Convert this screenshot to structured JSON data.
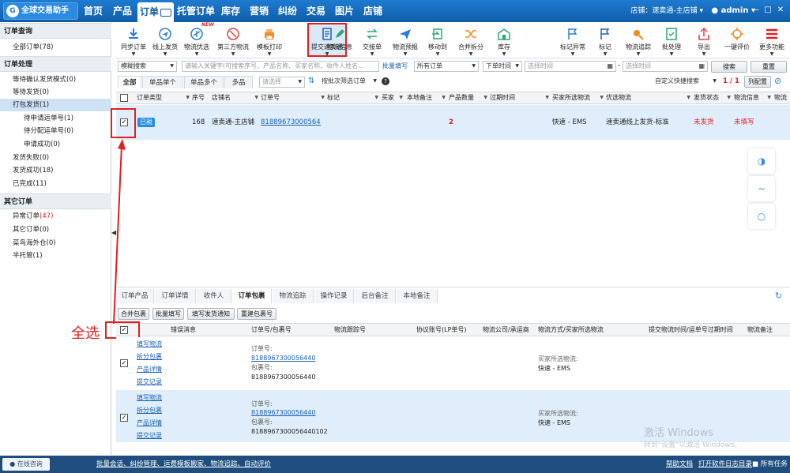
{
  "app": {
    "logo": "全球交易助手",
    "logo_icon": "G"
  },
  "nav": [
    "首页",
    "产品",
    "订单",
    "托管订单",
    "库存",
    "营销",
    "纠纷",
    "交易",
    "图片",
    "店铺"
  ],
  "header": {
    "store": "店铺：速卖通-主店铺",
    "store_arrow": "▾",
    "user": "admin",
    "user_arrow": "▾"
  },
  "left": {
    "sections": [
      {
        "title": "订单查询",
        "items": [
          {
            "label": "全部订单(78)"
          }
        ]
      },
      {
        "title": "订单处理",
        "items": [
          {
            "label": "等待确认发货模式(0)"
          },
          {
            "label": "等待发货(0)"
          },
          {
            "label": "打包发货(1)"
          },
          {
            "label": "待申请运单号(1)"
          },
          {
            "label": "待分配运单号(0)"
          },
          {
            "label": "申请成功(0)"
          },
          {
            "label": "发货失败(0)"
          },
          {
            "label": "发货成功(18)"
          },
          {
            "label": "已完成(11)"
          }
        ]
      },
      {
        "title": "其它订单",
        "items": [
          {
            "label": "异常订单",
            "count": "(47)"
          },
          {
            "label": "其它订单(0)"
          },
          {
            "label": "菜鸟海外仓(0)"
          },
          {
            "label": "半托管(1)"
          }
        ]
      }
    ]
  },
  "toolbar": [
    {
      "label": "同步订单",
      "icon": "download-icon"
    },
    {
      "label": "线上发货",
      "icon": "plane-icon"
    },
    {
      "label": "物流优选",
      "icon": "plane-circle-icon",
      "badge": "NEW"
    },
    {
      "label": "第三方物流",
      "icon": "cancel-plane-icon"
    },
    {
      "label": "模板打印",
      "icon": "printer-icon"
    },
    {
      "label": "提交速卖通",
      "icon": "document-icon"
    },
    {
      "label": "物流信息",
      "icon": "edit-icon"
    },
    {
      "label": "交接单",
      "icon": "swap-icon"
    },
    {
      "label": "物流预报",
      "icon": "send-icon"
    },
    {
      "label": "移动到",
      "icon": "move-icon"
    },
    {
      "label": "合并拆分",
      "icon": "shuffle-icon"
    },
    {
      "label": "库存",
      "icon": "warehouse-icon"
    },
    {
      "label": "标记异常",
      "icon": "flag-icon"
    },
    {
      "label": "标记",
      "icon": "flag-icon"
    },
    {
      "label": "物流追踪",
      "icon": "tracking-icon"
    },
    {
      "label": "批处理",
      "icon": "batch-icon"
    },
    {
      "label": "导出",
      "icon": "export-icon"
    },
    {
      "label": "一键评价",
      "icon": "star-icon"
    },
    {
      "label": "更多功能",
      "icon": "menu-icon"
    }
  ],
  "search": {
    "mode": "模糊搜索",
    "placeholder": "请输入关键字(可搜索序号、产品名称、买家名称、收件人姓名...",
    "batch": "批量填写",
    "order_type": "所有订单",
    "time_type": "下单时间",
    "date_from": "选择时间",
    "date_to": "选择时间",
    "date_sep": "-",
    "search_btn": "搜索",
    "reset_btn": "重置"
  },
  "tabs": [
    "全部",
    "单品单个",
    "单品多个",
    "多品"
  ],
  "filter": {
    "select": "请选择",
    "sort": "按批次筛选订单",
    "help": "?",
    "custom": "自定义快捷搜索",
    "page_cur": "1",
    "page_sep": "/",
    "page_total": "1",
    "columns_btn": "列配置"
  },
  "table": {
    "headers": [
      "订单类型",
      "序号",
      "店铺名",
      "订单号",
      "标记",
      "买家",
      "本地备注",
      "产品数量",
      "过期时间",
      "买家所选物流",
      "优选物流",
      "发货状态",
      "物流信息",
      "物流"
    ],
    "rows": [
      {
        "type": "已税",
        "seq": "168",
        "store": "速卖通-主店铺",
        "order_no": "818896730005644(",
        "qty": "2",
        "buyer_logistics": "快速 - EMS",
        "pref_logistics": "速卖通线上发货-标准",
        "ship_status": "未发货",
        "logistics_info": "未填写"
      }
    ]
  },
  "bottom": {
    "tabs": [
      "订单产品",
      "订单详情",
      "收件人",
      "订单包裹",
      "物流追踪",
      "操作记录",
      "后台备注",
      "本地备注"
    ],
    "buttons": [
      "合并包裹",
      "批量填写",
      "填写发货通知",
      "重建包裹号"
    ],
    "headers": [
      "错误消息",
      "订单号/包裹号",
      "物流跟踪号",
      "协议账号(LP单号)",
      "物流公司/承运商",
      "物流方式/买家所选物流",
      "提交物流时间/运单号过期时间",
      "物流备注"
    ],
    "rows": [
      {
        "links": [
          "填写物流",
          "拆分包裹",
          "产品详情",
          "提交记录"
        ],
        "order_label": "订单号:",
        "order_no": "8188967300056440",
        "pkg_label": "包裹号:",
        "pkg_no": "8188967300056440",
        "ship_label": "买家所选物流:",
        "ship": "快速 - EMS"
      },
      {
        "links": [
          "填写物流",
          "拆分包裹",
          "产品详情",
          "提交记录"
        ],
        "order_label": "订单号:",
        "order_no": "8188967300056440",
        "pkg_label": "包裹号:",
        "pkg_no": "8188967300056440102",
        "ship_label": "买家所选物流:",
        "ship": "快速 - EMS"
      }
    ]
  },
  "annotation": {
    "select_all": "全选"
  },
  "watermark": {
    "line1": "激活 Windows",
    "line2": "转到\"设置\"以激活 Windows。"
  },
  "status": {
    "online": "在线咨询",
    "links": "批量会话、纠纷管理、运费模板搬家、物流追踪、自动评价",
    "help": "帮助文档",
    "log": "打开软件日志目录",
    "tasks": "所有任务"
  },
  "colors": {
    "nav": "#1e7bd0",
    "accent": "#1a5fb4",
    "selected_row": "#dfeefa",
    "highlight": "#e02020",
    "status_bar": "#1f4e7e"
  }
}
